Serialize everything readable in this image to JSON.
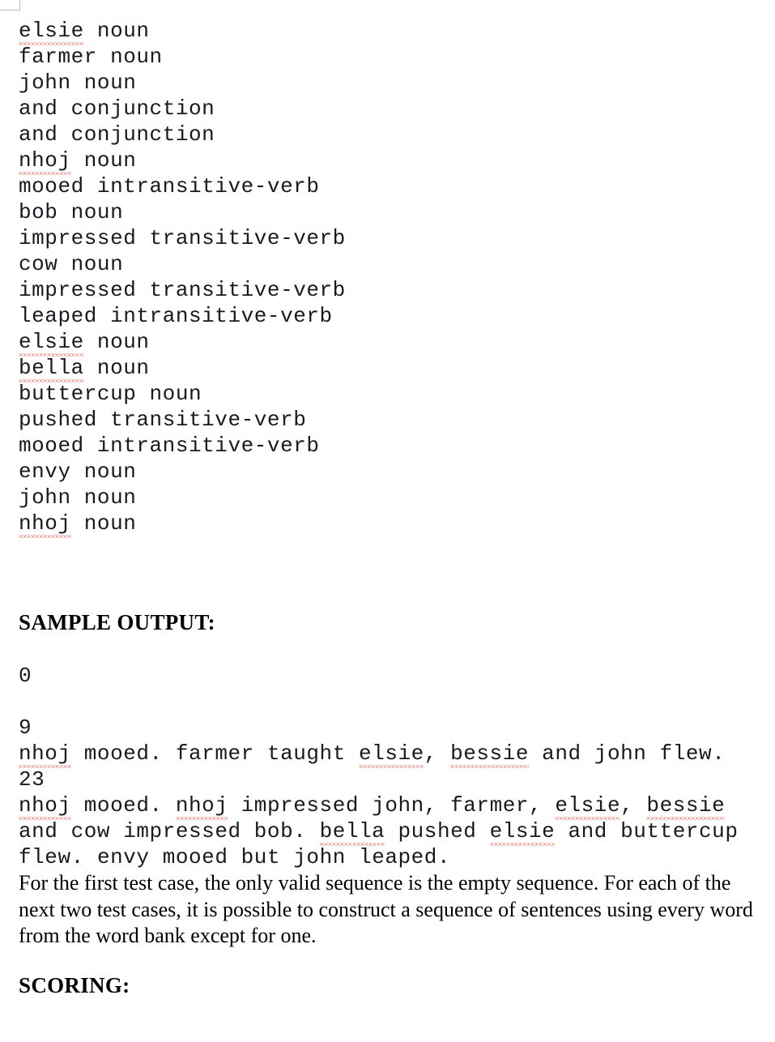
{
  "document": {
    "word_bank_lines": [
      "elsie noun",
      "farmer noun",
      "john noun",
      "and conjunction",
      "and conjunction",
      "nhoj noun",
      "mooed intransitive-verb",
      "bob noun",
      "impressed transitive-verb",
      "cow noun",
      "impressed transitive-verb",
      "leaped intransitive-verb",
      "elsie noun",
      "bella noun",
      "buttercup noun",
      "pushed transitive-verb",
      "mooed intransitive-verb",
      "envy noun",
      "john noun",
      "nhoj noun"
    ],
    "word_bank_entries": [
      {
        "word": "elsie",
        "pos": "noun",
        "misspelled": true
      },
      {
        "word": "farmer",
        "pos": "noun",
        "misspelled": false
      },
      {
        "word": "john",
        "pos": "noun",
        "misspelled": false
      },
      {
        "word": "and",
        "pos": "conjunction",
        "misspelled": false
      },
      {
        "word": "and",
        "pos": "conjunction",
        "misspelled": false
      },
      {
        "word": "nhoj",
        "pos": "noun",
        "misspelled": true
      },
      {
        "word": "mooed",
        "pos": "intransitive-verb",
        "misspelled": false
      },
      {
        "word": "bob",
        "pos": "noun",
        "misspelled": false
      },
      {
        "word": "impressed",
        "pos": "transitive-verb",
        "misspelled": false
      },
      {
        "word": "cow",
        "pos": "noun",
        "misspelled": false
      },
      {
        "word": "impressed",
        "pos": "transitive-verb",
        "misspelled": false
      },
      {
        "word": "leaped",
        "pos": "intransitive-verb",
        "misspelled": false
      },
      {
        "word": "elsie",
        "pos": "noun",
        "misspelled": true
      },
      {
        "word": "bella",
        "pos": "noun",
        "misspelled": true
      },
      {
        "word": "buttercup",
        "pos": "noun",
        "misspelled": false
      },
      {
        "word": "pushed",
        "pos": "transitive-verb",
        "misspelled": false
      },
      {
        "word": "mooed",
        "pos": "intransitive-verb",
        "misspelled": false
      },
      {
        "word": "envy",
        "pos": "noun",
        "misspelled": false
      },
      {
        "word": "john",
        "pos": "noun",
        "misspelled": false
      },
      {
        "word": "nhoj",
        "pos": "noun",
        "misspelled": true
      }
    ],
    "sample_output_heading": "SAMPLE OUTPUT:",
    "sample_output_lines": [
      "0",
      "",
      "9",
      "nhoj mooed. farmer taught elsie, bessie and john flew.",
      "23",
      "nhoj mooed. nhoj impressed john, farmer, elsie, bessie",
      "and cow impressed bob. bella pushed elsie and buttercup",
      "flew. envy mooed but john leaped."
    ],
    "sample_output_values": {
      "case_1_count": "0",
      "case_2_count": "9",
      "case_2_sentences": "nhoj mooed. farmer taught elsie, bessie and john flew.",
      "case_3_count": "23",
      "case_3_sentences": "nhoj mooed. nhoj impressed john, farmer, elsie, bessie and cow impressed bob. bella pushed elsie and buttercup flew. envy mooed but john leaped."
    },
    "explanation_paragraph": "For the first test case, the only valid sequence is the empty sequence. For each of the next two test cases, it is possible to construct a sequence of sentences using every word from the word bank except for one.",
    "scoring_heading": "SCORING:"
  },
  "colors": {
    "text": "#171a21",
    "heading": "#000000",
    "spellcheck_underline": "#e0211a",
    "corner_box_border": "#b9b9b9",
    "background": "#ffffff"
  }
}
